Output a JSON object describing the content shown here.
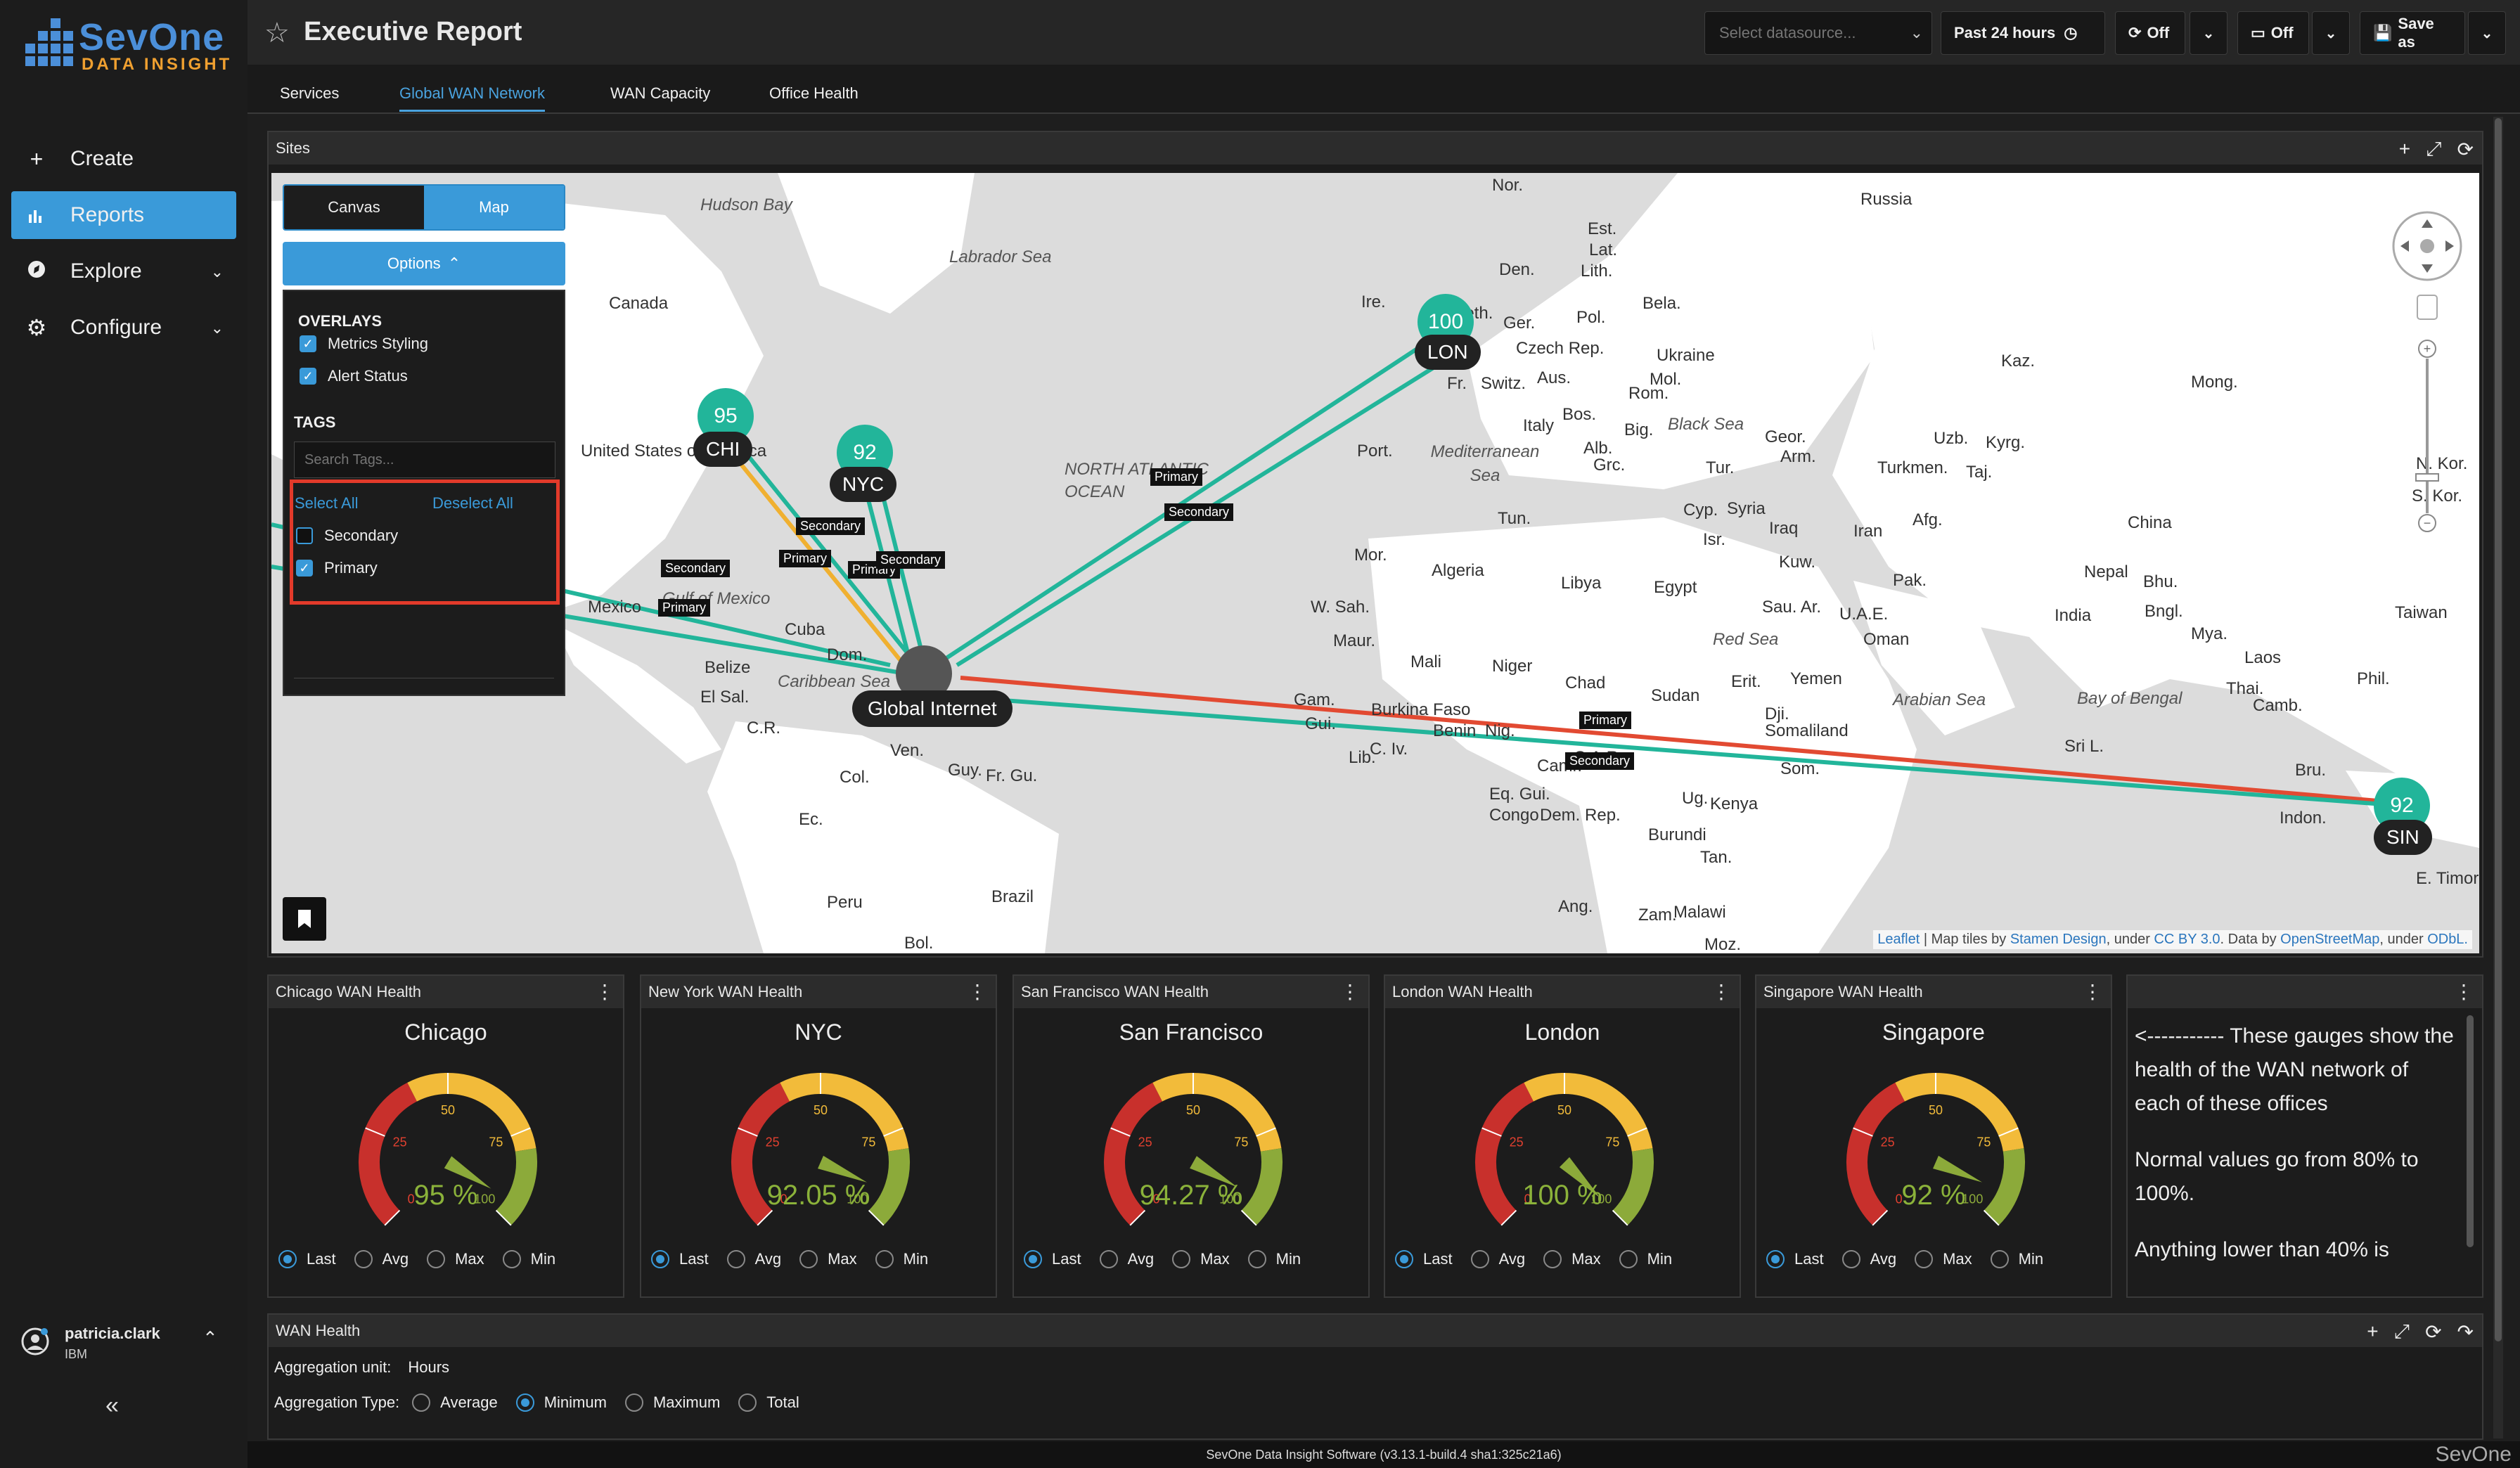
{
  "app": {
    "brand": "SevOne",
    "brand_sub": "DATA INSIGHT",
    "footer_text": "SevOne Data Insight Software (v3.13.1-build.4 sha1:325c21a6)",
    "footer_brand": "SevOne"
  },
  "sidebar": {
    "items": [
      {
        "label": "Create",
        "icon": "plus-icon"
      },
      {
        "label": "Reports",
        "icon": "bar-chart-icon"
      },
      {
        "label": "Explore",
        "icon": "compass-icon"
      },
      {
        "label": "Configure",
        "icon": "gears-icon"
      }
    ],
    "user": {
      "name": "patricia.clark",
      "org": "IBM"
    }
  },
  "header": {
    "title": "Executive Report",
    "datasource_placeholder": "Select datasource...",
    "time_range": "Past 24 hours",
    "refresh_state": "Off",
    "present_state": "Off",
    "save_label": "Save as"
  },
  "tabs": [
    "Services",
    "Global WAN Network",
    "WAN Capacity",
    "Office Health"
  ],
  "active_tab": "Global WAN Network",
  "sites_panel": {
    "title": "Sites",
    "view_toggle": [
      "Canvas",
      "Map"
    ],
    "active_view": "Map",
    "options_label": "Options",
    "overlays_heading": "OVERLAYS",
    "overlays": [
      {
        "label": "Metrics Styling",
        "checked": true
      },
      {
        "label": "Alert Status",
        "checked": true
      }
    ],
    "tags_heading": "TAGS",
    "tags_placeholder": "Search Tags...",
    "select_all": "Select All",
    "deselect_all": "Deselect All",
    "tags": [
      {
        "label": "Secondary",
        "checked": false
      },
      {
        "label": "Primary",
        "checked": true
      }
    ],
    "nodes": [
      {
        "id": "CHI",
        "value": "95"
      },
      {
        "id": "NYC",
        "value": "92"
      },
      {
        "id": "LON",
        "value": "100"
      },
      {
        "id": "SIN",
        "value": "92"
      }
    ],
    "hub_label": "Global Internet",
    "link_labels": [
      "Secondary",
      "Primary",
      "Secondary",
      "Primary",
      "Primary",
      "Secondary",
      "Primary",
      "Secondary",
      "Primary",
      "Secondary"
    ],
    "attribution": {
      "leaflet": "Leaflet",
      "tiles_prefix": " | Map tiles by ",
      "stamen": "Stamen Design",
      "under1": ", under ",
      "cc": "CC BY 3.0",
      "data_by": ". Data by ",
      "osm": "OpenStreetMap",
      "under2": ", under ",
      "odbl": "ODbL."
    }
  },
  "map_labels": {
    "countries": [
      "Russia",
      "Canada",
      "United States of America",
      "Mexico",
      "Cuba",
      "Belize",
      "El Sal.",
      "C.R.",
      "Dom.",
      "Ven.",
      "Col.",
      "Guy.",
      "Fr. Gu.",
      "Ec.",
      "Peru",
      "Brazil",
      "Bol.",
      "Nor.",
      "Est.",
      "Lat.",
      "Lith.",
      "Den.",
      "Ire.",
      "Neth.",
      "Ger.",
      "Pol.",
      "Bela.",
      "Czech Rep.",
      "Ukraine",
      "Fr.",
      "Switz.",
      "Aus.",
      "Mol.",
      "Rom.",
      "Italy",
      "Bos.",
      "Big.",
      "Alb.",
      "Grc.",
      "Port.",
      "Tun.",
      "Mor.",
      "Algeria",
      "Libya",
      "Egypt",
      "W. Sah.",
      "Maur.",
      "Mali",
      "Niger",
      "Chad",
      "Sudan",
      "Gam.",
      "Gui.",
      "Burkina Faso",
      "Benin",
      "Nig.",
      "C. Iv.",
      "Lib.",
      "Camr.",
      "C.A.R.",
      "Eq. Gui.",
      "Congo",
      "Dem. Rep.",
      "Ug.",
      "Kenya",
      "Burundi",
      "Tan.",
      "Ang.",
      "Zam.",
      "Malawi",
      "Moz.",
      "Som.",
      "Dji.",
      "Somaliland",
      "Erit.",
      "Yemen",
      "Oman",
      "U.A.E.",
      "Sau. Ar.",
      "Kuw.",
      "Iraq",
      "Iran",
      "Syria",
      "Cyp.",
      "Isr.",
      "Tur.",
      "Geor.",
      "Arm.",
      "Kaz.",
      "Uzb.",
      "Turkmen.",
      "Kyrg.",
      "Taj.",
      "Afg.",
      "Pak.",
      "India",
      "Nepal",
      "Bhu.",
      "Bngl.",
      "Mya.",
      "Laos",
      "Thai.",
      "Camb.",
      "Sri L.",
      "China",
      "Mong.",
      "Taiwan",
      "Phil.",
      "Bru.",
      "Indon.",
      "E. Timor",
      "N. Kor.",
      "S. Kor."
    ],
    "seas": [
      "Hudson Bay",
      "Labrador Sea",
      "NORTH ATLANTIC OCEAN",
      "Gulf of Mexico",
      "Caribbean Sea",
      "Mediterranean Sea",
      "Black Sea",
      "Red Sea",
      "Arabian Sea",
      "Bay of Bengal"
    ]
  },
  "gauges": [
    {
      "panel_title": "Chicago WAN Health",
      "title": "Chicago",
      "value": "95 %",
      "pct": 95
    },
    {
      "panel_title": "New York WAN Health",
      "title": "NYC",
      "value": "92.05 %",
      "pct": 92.05
    },
    {
      "panel_title": "San Francisco WAN Health",
      "title": "San Francisco",
      "value": "94.27 %",
      "pct": 94.27
    },
    {
      "panel_title": "London WAN Health",
      "title": "London",
      "value": "100 %",
      "pct": 100
    },
    {
      "panel_title": "Singapore WAN Health",
      "title": "Singapore",
      "value": "92 %",
      "pct": 92
    }
  ],
  "gauge_ticks": [
    "0",
    "25",
    "50",
    "75",
    "100"
  ],
  "gauge_modes": [
    "Last",
    "Avg",
    "Max",
    "Min"
  ],
  "note": {
    "line1": "<----------- These gauges show the health of the WAN network of each of these offices",
    "line2": "Normal values go from 80% to 100%.",
    "line3": "Anything lower than 40% is"
  },
  "wan_health": {
    "title": "WAN Health",
    "aggregation_unit_label": "Aggregation unit:",
    "aggregation_unit_value": "Hours",
    "aggregation_type_label": "Aggregation Type:",
    "types": [
      "Average",
      "Minimum",
      "Maximum",
      "Total"
    ],
    "selected_type": "Minimum"
  }
}
